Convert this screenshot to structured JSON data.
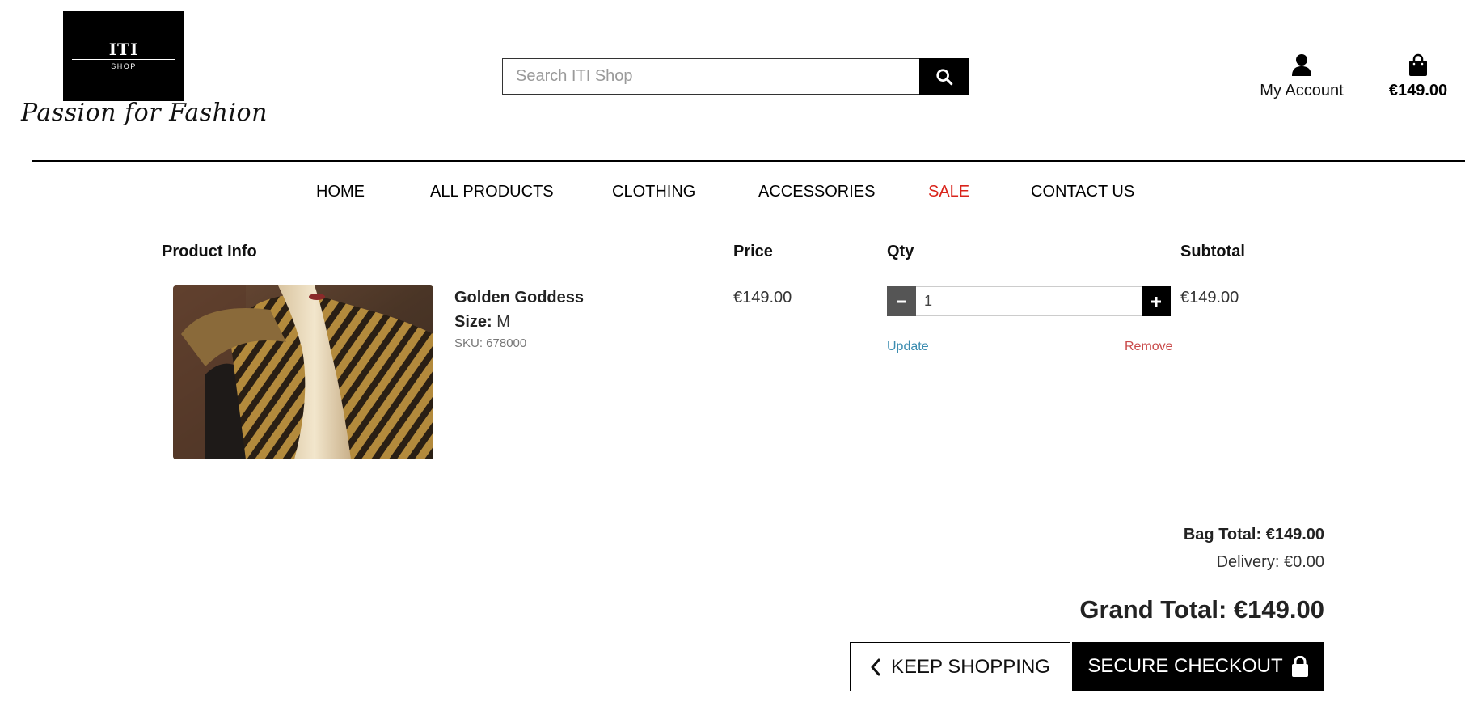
{
  "brand": {
    "logo_title": "ITI",
    "logo_sub": "SHOP",
    "tagline": "Passion for Fashion"
  },
  "search": {
    "placeholder": "Search ITI Shop",
    "icon": "search-icon"
  },
  "account": {
    "label": "My Account",
    "icon": "user-icon"
  },
  "bag": {
    "total": "€149.00",
    "icon": "shopping-bag-icon"
  },
  "nav": {
    "items": [
      {
        "label": "HOME"
      },
      {
        "label": "ALL PRODUCTS"
      },
      {
        "label": "CLOTHING"
      },
      {
        "label": "ACCESSORIES"
      },
      {
        "label": "SALE",
        "color": "#d9241b"
      },
      {
        "label": "CONTACT US"
      }
    ]
  },
  "table": {
    "headers": {
      "product_info": "Product Info",
      "price": "Price",
      "qty": "Qty",
      "subtotal": "Subtotal"
    }
  },
  "item": {
    "name": "Golden Goddess",
    "size_label": "Size:",
    "size_value": "M",
    "sku": "SKU: 678000",
    "price": "€149.00",
    "quantity": "1",
    "subtotal": "€149.00",
    "update_label": "Update",
    "remove_label": "Remove"
  },
  "totals": {
    "bag_total": "Bag Total: €149.00",
    "delivery": "Delivery: €0.00",
    "grand_total": "Grand Total: €149.00"
  },
  "actions": {
    "keep_shopping": "KEEP SHOPPING",
    "secure_checkout": "SECURE CHECKOUT"
  },
  "colors": {
    "sale": "#d9241b",
    "update_link": "#3b8cb0",
    "remove_link": "#c94a4a",
    "primary": "#000000"
  }
}
